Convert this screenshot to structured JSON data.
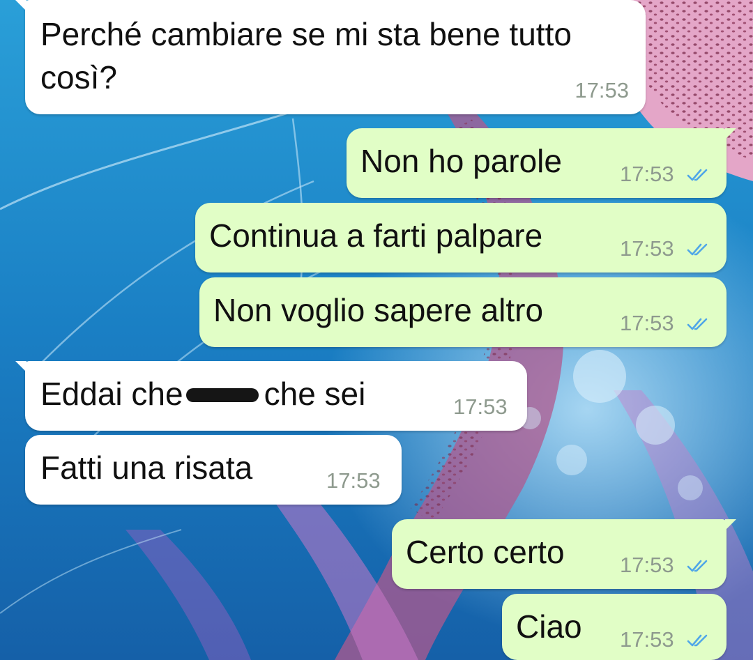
{
  "conversation": {
    "messages": [
      {
        "direction": "incoming",
        "text": "Perché cambiare se mi sta bene tutto così?",
        "time": "17:53"
      },
      {
        "direction": "outgoing",
        "text": "Non ho parole",
        "time": "17:53",
        "status": "read"
      },
      {
        "direction": "outgoing",
        "text": "Continua a farti palpare",
        "time": "17:53",
        "status": "read"
      },
      {
        "direction": "outgoing",
        "text": "Non voglio sapere altro",
        "time": "17:53",
        "status": "read"
      },
      {
        "direction": "incoming",
        "text_before": "Eddai che",
        "text_after": "che sei",
        "time": "17:53",
        "redacted": true
      },
      {
        "direction": "incoming",
        "text": "Fatti una risata",
        "time": "17:53"
      },
      {
        "direction": "outgoing",
        "text": "Certo certo",
        "time": "17:53",
        "status": "read"
      },
      {
        "direction": "outgoing",
        "text": "Ciao",
        "time": "17:53",
        "status": "read"
      }
    ]
  },
  "colors": {
    "incoming_bubble": "#ffffff",
    "outgoing_bubble": "#e1fec6",
    "read_ticks": "#4fa6e8",
    "timestamp": "#8e9a8e"
  },
  "icons": {
    "read_receipt": "double-check-icon"
  }
}
